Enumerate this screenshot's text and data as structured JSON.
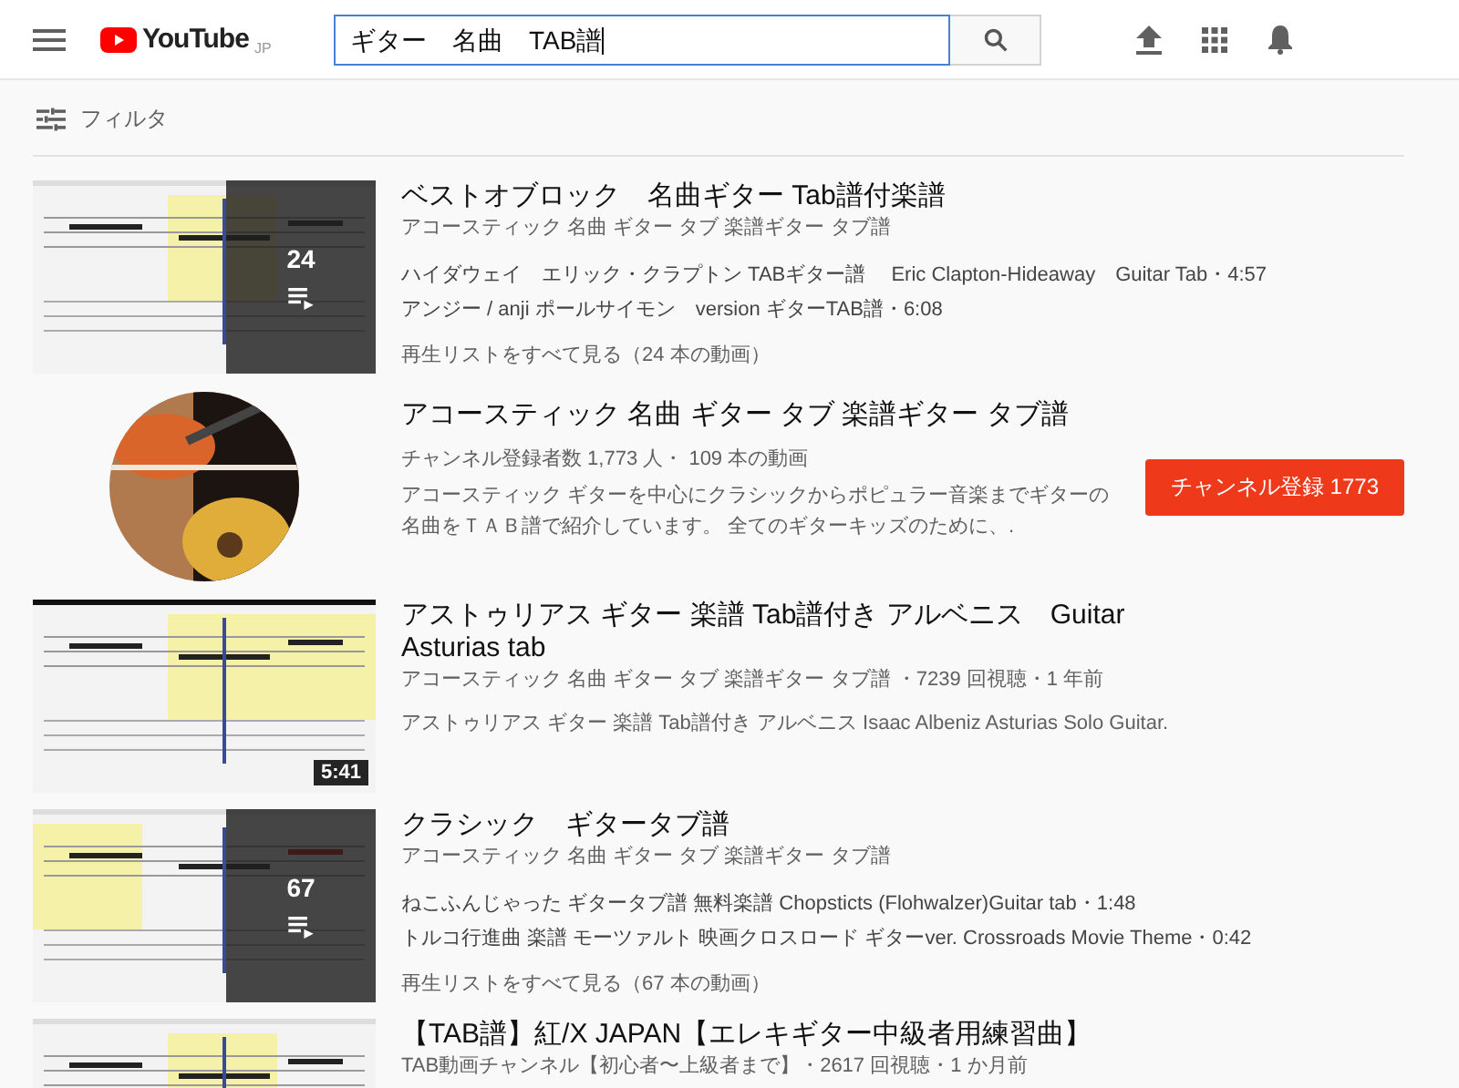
{
  "header": {
    "logo_badge": "JP",
    "logo_text": "YouTube",
    "search": {
      "value": "ギター　名曲　TAB譜"
    }
  },
  "filter": {
    "label": "フィルタ"
  },
  "results": [
    {
      "kind": "playlist",
      "title": "ベストオブロック　名曲ギター Tab譜付楽譜",
      "channel": "アコースティック 名曲 ギター タブ 楽譜ギター タブ譜",
      "videos": [
        "ハイダウェイ　エリック・クラプトン TABギター譜　 Eric Clapton-Hideaway　Guitar Tab・4:57",
        "アンジー / anji ポールサイモン　version ギターTAB譜・6:08"
      ],
      "count": "24",
      "view_all": "再生リストをすべて見る（24 本の動画）"
    },
    {
      "kind": "channel",
      "title": "アコースティック 名曲 ギター タブ 楽譜ギター タブ譜",
      "meta": "チャンネル登録者数 1,773 人・ 109 本の動画",
      "description": "アコースティック ギターを中心にクラシックからポピュラー音楽までギターの名曲をＴＡＢ譜で紹介しています。 全てのギターキッズのために、.",
      "subscribe": "チャンネル登録  1773"
    },
    {
      "kind": "video",
      "title": "アストゥリアス ギター 楽譜 Tab譜付き アルベニス　Guitar Asturias tab",
      "meta": "アコースティック 名曲 ギター タブ 楽譜ギター タブ譜 ・7239 回視聴・1 年前",
      "description": "アストゥリアス ギター 楽譜 Tab譜付き アルベニス Isaac Albeniz Asturias Solo Guitar.",
      "duration": "5:41"
    },
    {
      "kind": "playlist",
      "title": "クラシック　ギタータブ譜",
      "channel": "アコースティック 名曲 ギター タブ 楽譜ギター タブ譜",
      "videos": [
        "ねこふんじゃった ギタータブ譜 無料楽譜 Chopsticts (Flohwalzer)Guitar tab・1:48",
        "トルコ行進曲 楽譜 モーツァルト 映画クロスロード ギターver. Crossroads Movie Theme・0:42"
      ],
      "count": "67",
      "view_all": "再生リストをすべて見る（67 本の動画）"
    },
    {
      "kind": "video",
      "title": "【TAB譜】紅/X JAPAN【エレキギター中級者用練習曲】",
      "meta": "TAB動画チャンネル【初心者〜上級者まで】・2617 回視聴・1 か月前"
    }
  ]
}
